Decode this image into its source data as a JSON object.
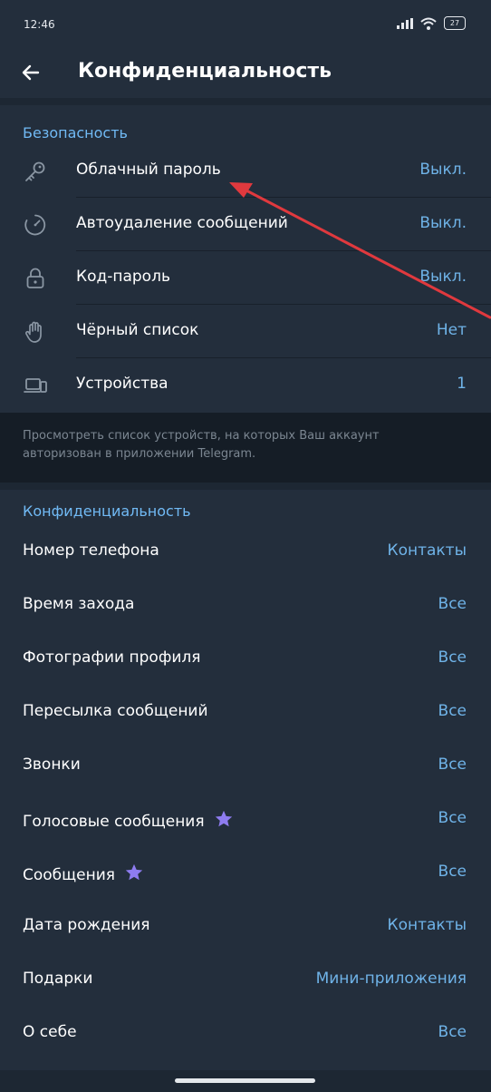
{
  "status": {
    "time": "12:46",
    "battery": "27"
  },
  "header": {
    "title": "Конфиденциальность"
  },
  "security": {
    "title": "Безопасность",
    "items": [
      {
        "label": "Облачный пароль",
        "value": "Выкл.",
        "icon": "key-icon"
      },
      {
        "label": "Автоудаление сообщений",
        "value": "Выкл.",
        "icon": "timer-icon"
      },
      {
        "label": "Код-пароль",
        "value": "Выкл.",
        "icon": "lock-icon"
      },
      {
        "label": "Чёрный список",
        "value": "Нет",
        "icon": "hand-icon"
      },
      {
        "label": "Устройства",
        "value": "1",
        "icon": "devices-icon"
      }
    ],
    "note": "Просмотреть список устройств, на которых Ваш аккаунт авторизован в приложении Telegram."
  },
  "privacy": {
    "title": "Конфиденциальность",
    "items": [
      {
        "label": "Номер телефона",
        "value": "Контакты"
      },
      {
        "label": "Время захода",
        "value": "Все"
      },
      {
        "label": "Фотографии профиля",
        "value": "Все"
      },
      {
        "label": "Пересылка сообщений",
        "value": "Все"
      },
      {
        "label": "Звонки",
        "value": "Все"
      },
      {
        "label": "Голосовые сообщения",
        "value": "Все",
        "premium": true
      },
      {
        "label": "Сообщения",
        "value": "Все",
        "premium": true
      },
      {
        "label": "Дата рождения",
        "value": "Контакты"
      },
      {
        "label": "Подарки",
        "value": "Мини-приложения"
      },
      {
        "label": "О себе",
        "value": "Все"
      }
    ]
  },
  "colors": {
    "accent": "#71baf5",
    "value": "#6fb3e8",
    "premium_star": "#8e7cf0",
    "annotation_arrow": "#e0393e"
  }
}
